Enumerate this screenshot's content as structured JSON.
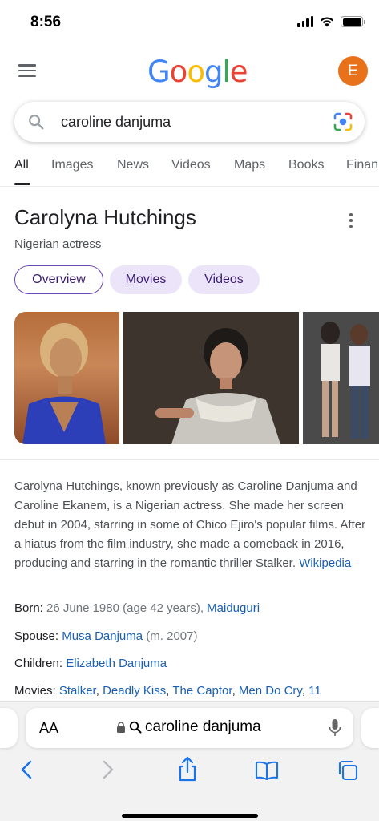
{
  "status_bar": {
    "time": "8:56"
  },
  "header": {
    "logo_letters": [
      "G",
      "o",
      "o",
      "g",
      "l",
      "e"
    ],
    "avatar_initial": "E",
    "avatar_color": "#e8711c"
  },
  "search": {
    "query": "caroline danjuma"
  },
  "tabs": [
    {
      "label": "All",
      "active": true
    },
    {
      "label": "Images"
    },
    {
      "label": "News"
    },
    {
      "label": "Videos"
    },
    {
      "label": "Maps"
    },
    {
      "label": "Books"
    },
    {
      "label": "Finan"
    }
  ],
  "knowledge_panel": {
    "title": "Carolyna Hutchings",
    "subtitle": "Nigerian actress",
    "chips": [
      {
        "label": "Overview",
        "selected": true
      },
      {
        "label": "Movies"
      },
      {
        "label": "Videos"
      }
    ],
    "description": "Carolyna Hutchings, known previously as Caroline Danjuma and Caroline Ekanem, is a Nigerian actress. She made her screen debut in 2004, starring in some of Chico Ejiro's popular films. After a hiatus from the film industry, she made a comeback in 2016, producing and starring in the romantic thriller Stalker.",
    "source_link": "Wikipedia",
    "facts": {
      "born": {
        "label": "Born:",
        "value": "26 June 1980 (age 42 years),",
        "link": "Maiduguri"
      },
      "spouse": {
        "label": "Spouse:",
        "link": "Musa Danjuma",
        "value": "(m. 2007)"
      },
      "children": {
        "label": "Children:",
        "link": "Elizabeth Danjuma"
      },
      "movies": {
        "label": "Movies:",
        "links": [
          "Stalker",
          "Deadly Kiss",
          "The Captor",
          "Men Do Cry",
          "11"
        ]
      }
    }
  },
  "safari": {
    "aa_label": "AA",
    "address": "caroline danjuma"
  },
  "colors": {
    "link": "#1a5fb4",
    "chip_bg": "#ece5fa",
    "chip_text": "#3c1e70"
  }
}
